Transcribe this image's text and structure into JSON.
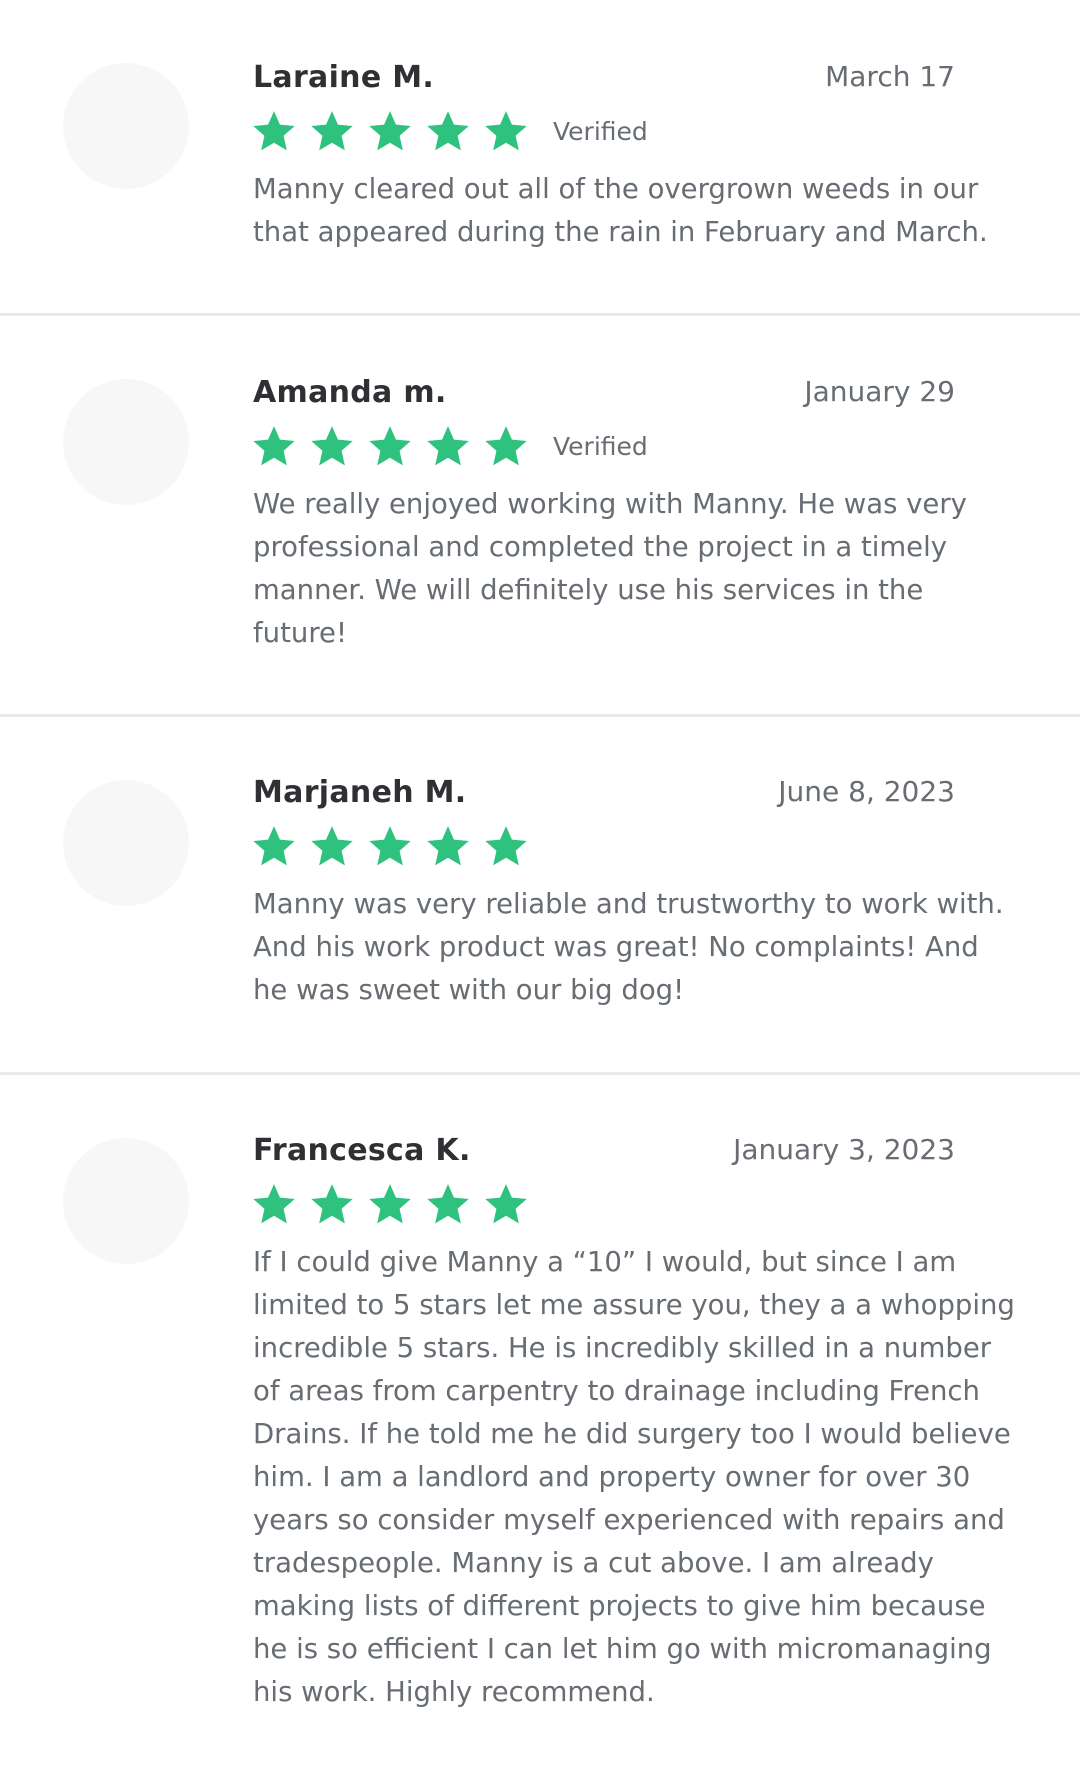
{
  "colors": {
    "star": "#2ec27e",
    "divider": "#e9eaec",
    "name": "#2f3033",
    "body_text": "#676d73",
    "avatar": "#f7f7f7"
  },
  "reviews": [
    {
      "name": "Laraine M.",
      "date": "March 17",
      "stars": 5,
      "verified_label": "Verified",
      "text": "Manny cleared out all of the overgrown weeds in our\nthat appeared during the rain in February and March."
    },
    {
      "name": "Amanda m.",
      "date": "January 29",
      "stars": 5,
      "verified_label": "Verified",
      "text": "We really enjoyed working with Manny. He was very\nprofessional and completed the project in a timely\nmanner.  We will definitely use his services in the\nfuture!"
    },
    {
      "name": "Marjaneh M.",
      "date": "June 8, 2023",
      "stars": 5,
      "text": "Manny was very reliable and trustworthy to work with.\nAnd his work product was great! No complaints! And\nhe was sweet with our big dog!"
    },
    {
      "name": "Francesca K.",
      "date": "January 3, 2023",
      "stars": 5,
      "text": "If I could give Manny a “10” I would, but since I am\nlimited to 5 stars let me assure you, they a a whopping\nincredible 5 stars.  He is incredibly skilled in a number\nof areas from carpentry to drainage including French\nDrains.  If he told me he did surgery too I would believe\nhim.  I am a landlord and property owner for over 30\nyears so consider myself experienced with repairs and\ntradespeople.  Manny is a cut above.  I am already\nmaking lists of different projects to give him because\nhe is so efficient I can let him go with micromanaging\nhis work.  Highly recommend."
    }
  ]
}
